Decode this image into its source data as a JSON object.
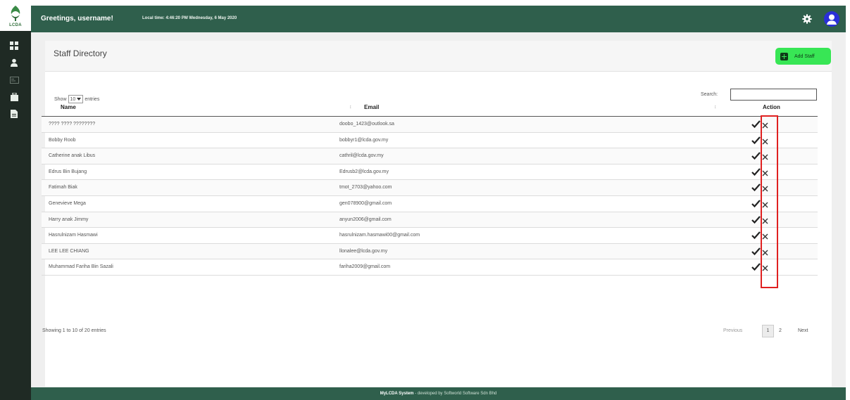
{
  "brand": {
    "logo_text": "LCDA"
  },
  "header": {
    "greeting": "Greetings, username!",
    "local_time": "Local time: 4:46:20 PM Wednesday, 6 May 2020"
  },
  "sidebar": {
    "items": [
      {
        "icon": "dashboard-icon"
      },
      {
        "icon": "user-icon"
      },
      {
        "icon": "card-icon"
      },
      {
        "icon": "briefcase-icon"
      },
      {
        "icon": "document-icon"
      }
    ]
  },
  "page": {
    "title": "Staff Directory",
    "add_button": "Add Staff"
  },
  "controls": {
    "show_prefix": "Show",
    "page_size": "10",
    "show_suffix": "entries",
    "search_label": "Search:",
    "search_value": ""
  },
  "table": {
    "columns": {
      "name": "Name",
      "email": "Email",
      "action": "Action"
    },
    "rows": [
      {
        "name": "???? ???? ????????",
        "email": "doobo_1423@outlook.sa"
      },
      {
        "name": "Bobby Roob",
        "email": "bobbyr1@lcda.gov.my"
      },
      {
        "name": "Catherine anak Libus",
        "email": "cathril@lcda.gov.my"
      },
      {
        "name": "Edrus Bin Bujang",
        "email": "Edrusb2@lcda.gov.my"
      },
      {
        "name": "Fatimah Biak",
        "email": "tmot_2703@yahoo.com"
      },
      {
        "name": "Genevieve Mega",
        "email": "gen078900@gmail.com"
      },
      {
        "name": "Harry anak Jimmy",
        "email": "anyun2006@gmail.com"
      },
      {
        "name": "Hasrulnizam Hasmawi",
        "email": "hasrulnizam.hasmawi00@gmail.com"
      },
      {
        "name": "LEE LEE CHIANG",
        "email": "llonalee@lcda.gov.my"
      },
      {
        "name": "Muhammad Fariha Bin Sazali",
        "email": "fariha2009@gmail.com"
      }
    ]
  },
  "pagination": {
    "info": "Showing 1 to 10 of 20 entries",
    "previous": "Previous",
    "pages": [
      "1",
      "2"
    ],
    "next": "Next"
  },
  "footer": {
    "system": "MyLCDA System",
    "credit": "- developed by Softworld Software Sdn Bhd"
  },
  "colors": {
    "sidebar": "#1f2a24",
    "header": "#2f5f4c",
    "add_button": "#38e655",
    "highlight": "#e02020",
    "avatar": "#2a2fd9"
  }
}
